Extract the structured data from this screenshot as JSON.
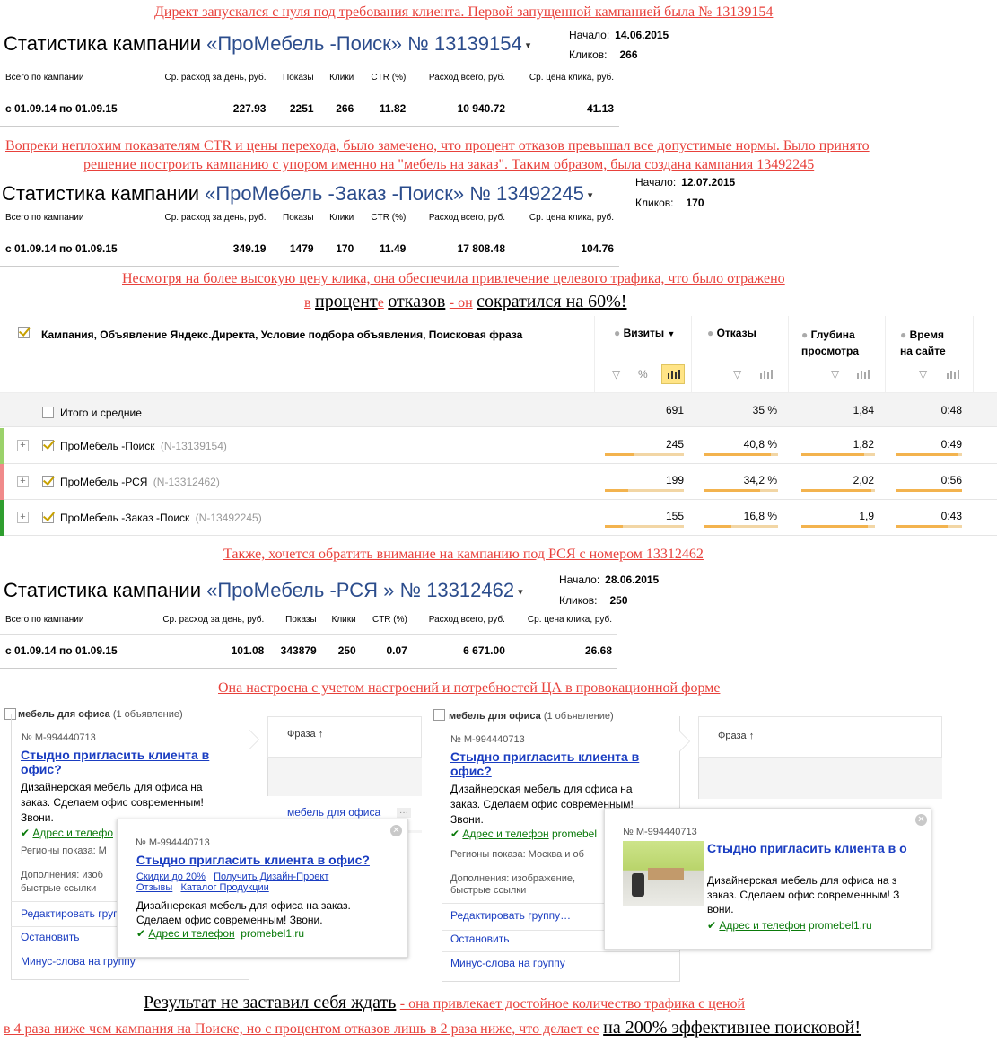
{
  "notes": {
    "n1": "Директ запускался с нуля под требования клиента. Первой запущенной кампанией была № 13139154",
    "n2a": "Вопреки неплохим показателям CTR и цены перехода, было замечено, что процент отказов превышал все допустимые нормы. Было принято",
    "n2b": "решение построить кампанию с упором именно на \"мебель на заказ\". Таким образом, была создана кампания 13492245",
    "n3a": "Несмотря на более высокую цену клика, она обеспечила привлечение целевого трафика, что было отражено",
    "n3b1": "в",
    "n3b2": "процент",
    "n3b3": "е",
    "n3b4": "отказов",
    "n3b5": "- он",
    "n3b6": "сократился на 60%!",
    "n4": "Также, хочется обратить внимание на кампанию под РСЯ с номером 13312462",
    "n5": "Она настроена с учетом настроений и потребностей ЦА в провокационной форме",
    "n6a1": "Результат не заставил себя ждать",
    "n6a2": "-  она привлекает достойное количество трафика с ценой",
    "n6b1": "в 4 раза ниже чем кампания на Поиске, но с процентом отказов лишь в 2 раза ниже, что делает ее",
    "n6b2": "на 200% эффективнее поисковой!"
  },
  "stat_headers": {
    "total": "Всего по кампании",
    "avg_day": "Ср. расход за день, руб.",
    "shows": "Показы",
    "clicks": "Клики",
    "ctr": "CTR (%)",
    "total_spend": "Расход всего, руб.",
    "avg_cpc": "Ср. цена клика, руб."
  },
  "campaigns": [
    {
      "title_prefix": "Статистика кампании",
      "name": "«ПроМебель -Поиск»",
      "number": "№ 13139154",
      "dd": "▾",
      "start_label": "Начало:",
      "start": "14.06.2015",
      "clicks_label": "Кликов:",
      "clicks_total": "266",
      "period": "с 01.09.14 по 01.09.15",
      "avg_day": "227.93",
      "shows": "2251",
      "clicks": "266",
      "ctr": "11.82",
      "total_spend": "10 940.72",
      "avg_cpc": "41.13"
    },
    {
      "title_prefix": "Статистика кампании",
      "name": "«ПроМебель -Заказ -Поиск»",
      "number": "№ 13492245",
      "dd": "▾",
      "start_label": "Начало:",
      "start": "12.07.2015",
      "clicks_label": "Кликов:",
      "clicks_total": "170",
      "period": "с 01.09.14 по 01.09.15",
      "avg_day": "349.19",
      "shows": "1479",
      "clicks": "170",
      "ctr": "11.49",
      "total_spend": "17 808.48",
      "avg_cpc": "104.76"
    },
    {
      "title_prefix": "Статистика кампании",
      "name": "«ПроМебель -РСЯ »",
      "number": "№ 13312462",
      "dd": "▾",
      "start_label": "Начало:",
      "start": "28.06.2015",
      "clicks_label": "Кликов:",
      "clicks_total": "250",
      "period": "с 01.09.14 по 01.09.15",
      "avg_day": "101.08",
      "shows": "343879",
      "clicks": "250",
      "ctr": "0.07",
      "total_spend": "6 671.00",
      "avg_cpc": "26.68"
    }
  ],
  "metrika": {
    "col_main": "Кампания, Объявление Яндекс.Директа, Условие подбора объявления, Поисковая фраза",
    "col_visits": "Визиты",
    "col_bounce": "Отказы",
    "col_depth1": "Глубина",
    "col_depth2": "просмотра",
    "col_time1": "Время",
    "col_time2": "на сайте",
    "sort_arrow": "▼",
    "percent": "%",
    "total": {
      "label": "Итого и средние",
      "visits": "691",
      "bounce": "35 %",
      "depth": "1,84",
      "time": "0:48"
    },
    "rows": [
      {
        "name": "ПроМебель -Поиск",
        "id": "(N-13139154)",
        "visits": "245",
        "bounce": "40,8 %",
        "depth": "1,82",
        "time": "0:49",
        "color": "#9bd26a",
        "visits_frac": 0.36,
        "bounce_frac": 0.9,
        "depth_frac": 0.85,
        "time_frac": 0.95
      },
      {
        "name": "ПроМебель -РСЯ",
        "id": "(N-13312462)",
        "visits": "199",
        "bounce": "34,2 %",
        "depth": "2,02",
        "time": "0:56",
        "color": "#f08a8a",
        "visits_frac": 0.29,
        "bounce_frac": 0.75,
        "depth_frac": 0.95,
        "time_frac": 1.0
      },
      {
        "name": "ПроМебель -Заказ -Поиск",
        "id": "(N-13492245)",
        "visits": "155",
        "bounce": "16,8 %",
        "depth": "1,9",
        "time": "0:43",
        "color": "#2f9e2f",
        "visits_frac": 0.23,
        "bounce_frac": 0.37,
        "depth_frac": 0.9,
        "time_frac": 0.78
      }
    ]
  },
  "ads": {
    "group_name": "мебель для офиса",
    "group_count": "(1 объявление)",
    "ad_number": "№ M-994440713",
    "ad_title_short": "Стыдно пригласить клиента в офис?",
    "ad_title_cut": "Стыдно пригласить клиента в о",
    "ad_body": "Дизайнерская мебель для офиса на заказ. Сделаем офис современным! Звони.",
    "ad_body_b": "Дизайнерская мебель для офиса на з заказ. Сделаем офис современным! З вони.",
    "address": "Адрес и телефон",
    "address_cut": "Адрес и телефо",
    "domain": "promebel1.ru",
    "domain_cut": "promebel",
    "regions": "Регионы показа: М",
    "regions_b": "Регионы показа: Москва и об",
    "extras": "Дополнения: изоб",
    "extras_b": "Дополнения: изображение,",
    "quick_links": "быстрые ссылки",
    "edit_group": "Редактировать груп",
    "edit_group_b": "Редактировать группу…",
    "stop": "Остановить",
    "minus": "Минус-слова на группу",
    "phrase_header": "Фраза ↑",
    "phrase": "мебель для офиса",
    "more": "···",
    "sitelinks": [
      "Скидки до 20%",
      "Получить Дизайн-Проект",
      "Отзывы",
      "Каталог Продукции"
    ]
  }
}
